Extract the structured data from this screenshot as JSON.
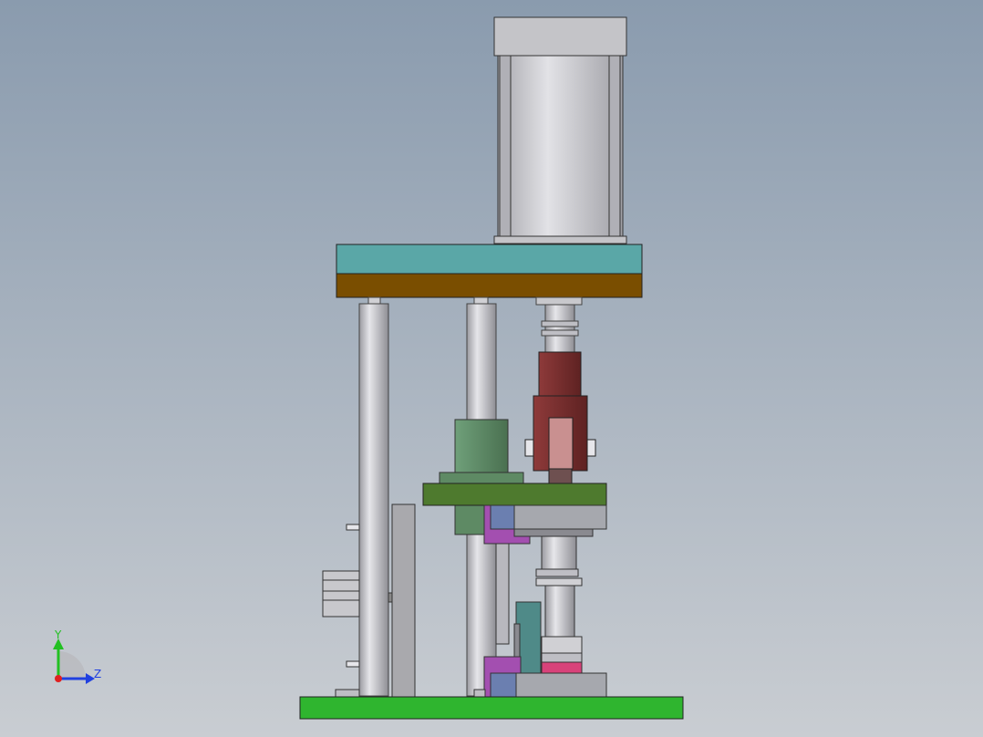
{
  "scene": {
    "background_top": "#8A9BAE",
    "background_bottom": "#C9CDD2",
    "colors": {
      "cylinder_body": "#C8C8CC",
      "cylinder_cap": "#B9B9BD",
      "top_plate": "#5AA7A7",
      "top_plate_lower": "#7A4E00",
      "guide_rod": "#C4C4C8",
      "clevis": "#7A2E2E",
      "clevis_inner": "#C99090",
      "mid_plate": "#4E7A2E",
      "bushing_green": "#5E8A64",
      "purple_bracket": "#A34FB0",
      "blue_block": "#6B7FB0",
      "gray_block": "#A6A8AE",
      "teal_part": "#4F8A88",
      "pink_part": "#D8427A",
      "base_plate": "#2FB52F",
      "side_panel": "#A9A9AD"
    }
  },
  "triad": {
    "y_label": "Y",
    "z_label": "Z",
    "y_color": "#22C022",
    "z_color": "#2040E0",
    "x_color": "#E02020"
  }
}
